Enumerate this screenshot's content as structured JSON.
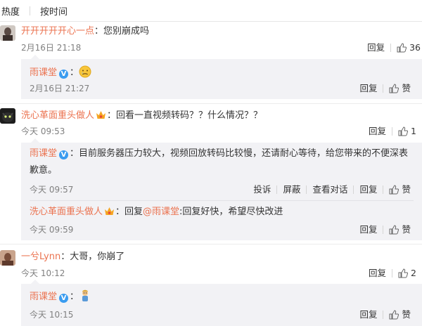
{
  "sort": {
    "hot": "热度",
    "time": "按时间"
  },
  "comments": [
    {
      "user": "开开开开开心一点",
      "text": "：您别崩成吗",
      "time": "2月16日 21:18",
      "reply_label": "回复",
      "likes": "36",
      "replies": [
        {
          "user": "雨课堂",
          "text": "：",
          "emoji": "sad-face-emoji",
          "time": "2月16日 21:27",
          "reply_label": "回复",
          "like_label": "赞"
        }
      ]
    },
    {
      "user": "洗心革面重头做人",
      "text": "：回看一直视频转码？？什么情况？？",
      "time": "今天 09:53",
      "reply_label": "回复",
      "likes": "1",
      "replies": [
        {
          "user": "雨课堂",
          "text": "：目前服务器压力较大，视频回放转码比较慢，还请耐心等待，给您带来的不便深表歉意。",
          "time": "今天 09:57",
          "report_label": "投诉",
          "block_label": "屏蔽",
          "dialog_label": "查看对话",
          "reply_label": "回复",
          "like_label": "赞"
        },
        {
          "user": "洗心革面重头做人",
          "text_prefix": "：回复",
          "mention": "@雨课堂",
          "text": ":回复好快，希望尽快改进",
          "time": "今天 09:59",
          "reply_label": "回复",
          "like_label": "赞"
        }
      ]
    },
    {
      "user": "一兮Lynn",
      "text": "：大哥，你崩了",
      "time": "今天 10:12",
      "reply_label": "回复",
      "likes": "2",
      "replies": [
        {
          "user": "雨课堂",
          "text": "：",
          "emoji": "doll-emoji",
          "time": "今天 10:15",
          "reply_label": "回复",
          "like_label": "赞"
        }
      ]
    }
  ],
  "colors": {
    "username": "#eb7350",
    "reply_bg": "#f2f2f5",
    "verified_badge": "#3a9cf0",
    "meta": "#808080"
  },
  "badges": {
    "verified": "V"
  }
}
